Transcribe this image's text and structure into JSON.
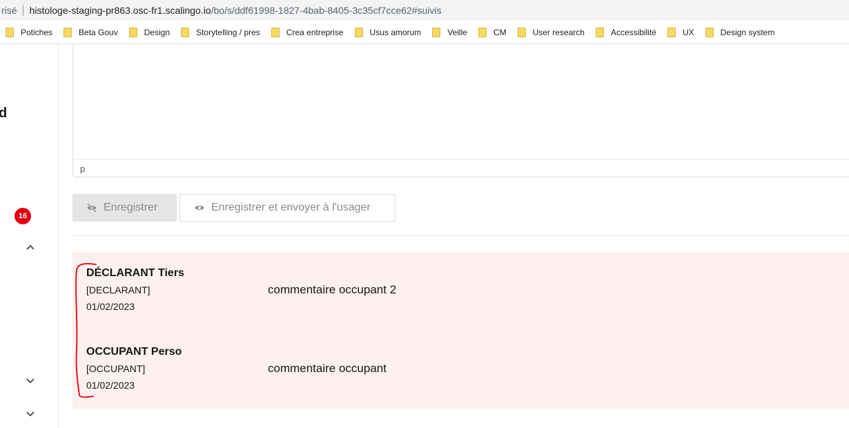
{
  "browser": {
    "address_prefix": "risé",
    "address_host": "histologe-staging-pr863.osc-fr1.scalingo.io",
    "address_path": "/bo/s/ddf61998-1827-4bab-8405-3c35cf7cce62#suivis"
  },
  "bookmarks": [
    {
      "label": "Potiches"
    },
    {
      "label": "Beta Gouv"
    },
    {
      "label": "Design"
    },
    {
      "label": "Storytelling / pres"
    },
    {
      "label": "Crea entreprise"
    },
    {
      "label": "Usus amorum"
    },
    {
      "label": "Veille"
    },
    {
      "label": "CM"
    },
    {
      "label": "User research"
    },
    {
      "label": "Accessibilité"
    },
    {
      "label": "UX"
    },
    {
      "label": "Design system"
    }
  ],
  "sidebar": {
    "partial_letter": "d",
    "badge_count": "16",
    "chevrons": [
      "chevron-up-icon",
      "chevron-down-icon",
      "chevron-down-icon"
    ]
  },
  "editor": {
    "status_path": "p"
  },
  "actions": {
    "save_label": "Enregistrer",
    "save_icon": "eye-off-icon",
    "send_label": "Enregistrer et envoyer à l'usager",
    "send_icon": "eye-icon"
  },
  "suivis": [
    {
      "author": "DÉCLARANT Tiers",
      "role": "[DECLARANT]",
      "date": "01/02/2023",
      "comment": "commentaire occupant 2"
    },
    {
      "author": "OCCUPANT Perso",
      "role": "[OCCUPANT]",
      "date": "01/02/2023",
      "comment": "commentaire occupant"
    }
  ],
  "colors": {
    "panel_bg": "#fdf0ef",
    "badge": "#e1000f",
    "annotation": "#e1000f"
  }
}
